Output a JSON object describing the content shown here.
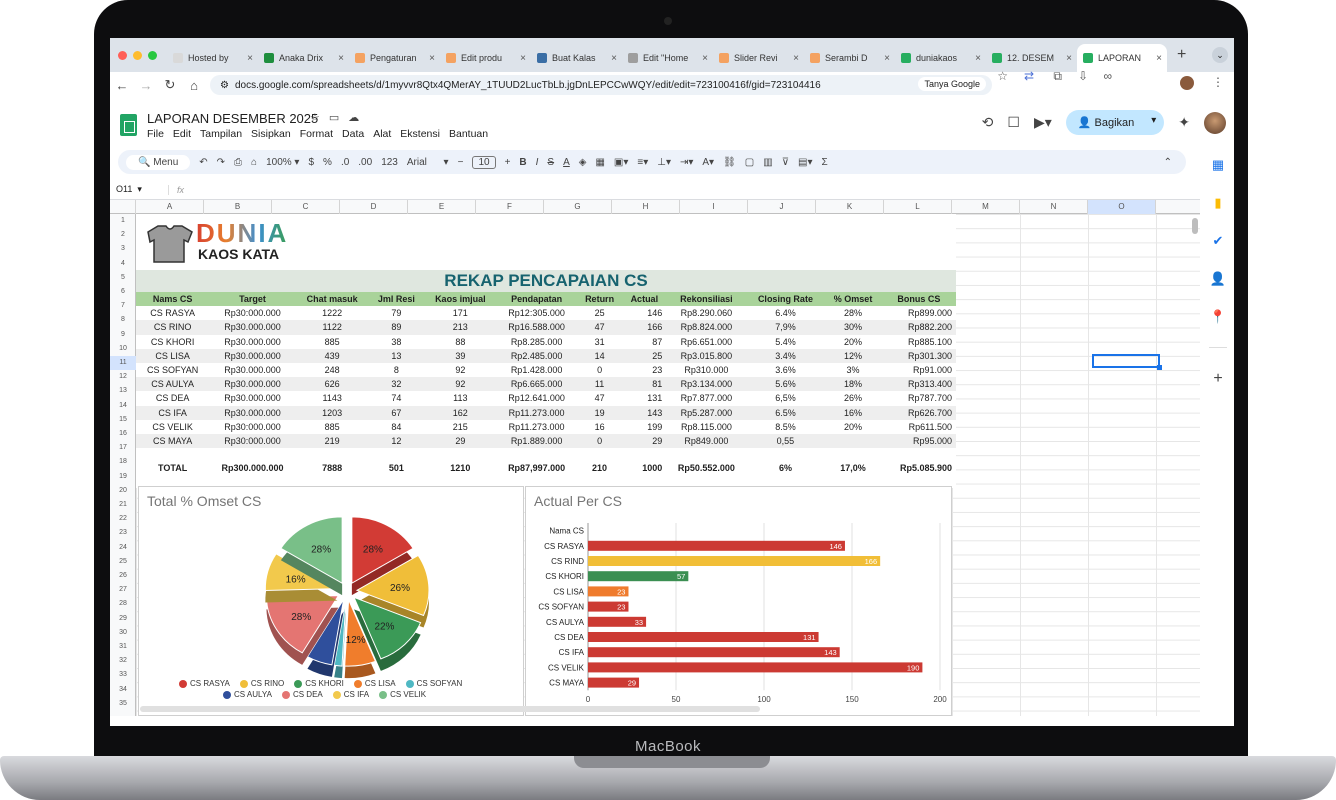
{
  "device": {
    "label": "MacBook"
  },
  "browser": {
    "tabs": [
      {
        "label": "Hosted by",
        "color": "#d9d9d9"
      },
      {
        "label": "Anaka Drix",
        "color": "#1e8e3e"
      },
      {
        "label": "Pengaturan",
        "color": "#f4a261"
      },
      {
        "label": "Edit produ",
        "color": "#f4a261"
      },
      {
        "label": "Buat Kalas",
        "color": "#3a6ea5"
      },
      {
        "label": "Edit \"Home",
        "color": "#9e9e9e"
      },
      {
        "label": "Slider Revi",
        "color": "#f4a261"
      },
      {
        "label": "Serambi D",
        "color": "#f4a261"
      },
      {
        "label": "duniakaos",
        "color": "#27ae60"
      },
      {
        "label": "12. DESEM",
        "color": "#27ae60"
      },
      {
        "label": "LAPORAN",
        "color": "#27ae60"
      }
    ],
    "url": "docs.google.com/spreadsheets/d/1myvvr8Qtx4QMerAY_1TUUD2LucTbLb.jgDnLEPCCwWQY/edit/edit=723100416f/gid=723104416",
    "ask_google": "Tanya Google"
  },
  "sheets": {
    "title": "LAPORAN DESEMBER 2025",
    "menu": [
      "File",
      "Edit",
      "Tampilan",
      "Sisipkan",
      "Format",
      "Data",
      "Alat",
      "Ekstensi",
      "Bantuan"
    ],
    "share": "Bagikan",
    "toolbar": {
      "menu": "Menu",
      "zoom": "100%",
      "currency": "$",
      "percent": "%",
      "dec1": ".0",
      "dec2": ".00",
      "num": "123",
      "font": "Arial",
      "font_size": "10",
      "bold": "B",
      "italic": "I",
      "strike": "S",
      "textcolor": "A"
    },
    "cell_ref": "O11",
    "columns": [
      "A",
      "B",
      "C",
      "D",
      "E",
      "F",
      "G",
      "H",
      "I",
      "J",
      "K",
      "L",
      "M",
      "N",
      "O"
    ],
    "rows": [
      "1",
      "2",
      "3",
      "4",
      "5",
      "6",
      "7",
      "8",
      "9",
      "10",
      "11",
      "12",
      "13",
      "14",
      "15",
      "16",
      "17",
      "18",
      "19",
      "20",
      "21",
      "22",
      "23",
      "24",
      "25",
      "26",
      "27",
      "28",
      "29",
      "30",
      "31",
      "32",
      "33",
      "34",
      "35"
    ]
  },
  "report": {
    "brand_top": "DUNIA",
    "brand_bottom": "KAOS KATA",
    "title": "REKAP PENCAPAIAN CS",
    "headers": [
      "Nams CS",
      "Target",
      "Chat masuk",
      "Jml Resi",
      "Kaos imjual",
      "Pendapatan",
      "Return",
      "Actual",
      "Rekonsiliasi",
      "Closing Rate",
      "% Omset",
      "Bonus CS"
    ],
    "rows": [
      [
        "CS RASYA",
        "Rp30:000.000",
        "1222",
        "79",
        "171",
        "Rp12:305.000",
        "25",
        "146",
        "Rp8.290.060",
        "6.4%",
        "28%",
        "Rp899.000"
      ],
      [
        "CS RINO",
        "Rp30.000.000",
        "1122",
        "89",
        "213",
        "Rp16.588.000",
        "47",
        "166",
        "Rp8.824.000",
        "7,9%",
        "30%",
        "Rp882.200"
      ],
      [
        "CS KHORI",
        "Rp30.000.000",
        "885",
        "38",
        "88",
        "Rp8.285.000",
        "31",
        "87",
        "Rp6.651.000",
        "5.4%",
        "20%",
        "Rp885.100"
      ],
      [
        "CS LISA",
        "Rp30.000.000",
        "439",
        "13",
        "39",
        "Rp2.485.000",
        "14",
        "25",
        "Rp3.015.800",
        "3.4%",
        "12%",
        "Rp301.300"
      ],
      [
        "CS SOFYAN",
        "Rp30.000.000",
        "248",
        "8",
        "92",
        "Rp1.428.000",
        "0",
        "23",
        "Rp310.000",
        "3.6%",
        "3%",
        "Rp91.000"
      ],
      [
        "CS AULYA",
        "Rp30.000.000",
        "626",
        "32",
        "92",
        "Rp6.665.000",
        "11",
        "81",
        "Rp3.134.000",
        "5.6%",
        "18%",
        "Rp313.400"
      ],
      [
        "CS DEA",
        "Rp30.000.000",
        "1143",
        "74",
        "113",
        "Rp12.641.000",
        "47",
        "131",
        "Rp7.877.000",
        "6,5%",
        "26%",
        "Rp787.700"
      ],
      [
        "CS IFA",
        "Rp30.000.000",
        "1203",
        "67",
        "162",
        "Rp11.273.000",
        "19",
        "143",
        "Rp5.287.000",
        "6.5%",
        "16%",
        "Rp626.700"
      ],
      [
        "CS VELIK",
        "Rp30:000.000",
        "885",
        "84",
        "215",
        "Rp11.273.000",
        "16",
        "199",
        "Rp8.115.000",
        "8.5%",
        "20%",
        "Rp611.500"
      ],
      [
        "CS MAYA",
        "Rp30:000.000",
        "219",
        "12",
        "29",
        "Rp1.889.000",
        "0",
        "29",
        "Rp849.000",
        "0,55",
        "",
        "Rp95.000"
      ]
    ],
    "total": [
      "TOTAL",
      "Rp300.000.000",
      "7888",
      "501",
      "1210",
      "Rp87,997.000",
      "210",
      "1000",
      "Rp50.552.000",
      "6%",
      "17,0%",
      "Rp5.085.900"
    ]
  },
  "chart_data": [
    {
      "type": "pie",
      "title": "Total % Omset CS",
      "slices": [
        {
          "label": "CS RASYA",
          "value": 28,
          "text": "28%",
          "color": "#d23b35"
        },
        {
          "label": "CS RINO",
          "value": 26,
          "text": "26%",
          "color": "#f0be39"
        },
        {
          "label": "CS KHORI",
          "value": 22,
          "text": "22%",
          "color": "#3b9a57"
        },
        {
          "label": "CS LISA",
          "value": 12,
          "text": "12%",
          "color": "#f07d2c"
        },
        {
          "label": "CS SOFYAN",
          "value": 3,
          "text": "",
          "color": "#4fb8c3"
        },
        {
          "label": "CS AULYA",
          "value": 10,
          "text": "",
          "color": "#2f4f9c"
        },
        {
          "label": "CS DEA",
          "value": 28,
          "text": "28%",
          "color": "#e47572"
        },
        {
          "label": "CS IFA",
          "value": 16,
          "text": "16%",
          "color": "#f2c94c"
        },
        {
          "label": "CS VELIK",
          "value": 28,
          "text": "28%",
          "color": "#79bf88"
        }
      ],
      "legend": [
        "CS RASYA",
        "CS RINO",
        "CS KHORI",
        "CS LISA",
        "CS SOFYAN",
        "CS AULYA",
        "CS DEA",
        "CS IFA",
        "CS VELIK"
      ],
      "legend_position": "bottom"
    },
    {
      "type": "bar",
      "orientation": "horizontal",
      "title": "Actual Per CS",
      "categories": [
        "Nama CS",
        "CS RASYA",
        "CS RIND",
        "CS KHORI",
        "CS LISA",
        "CS SOFYAN",
        "CS AULYA",
        "CS DEA",
        "CS IFA",
        "CS VELIK",
        "CS MAYA"
      ],
      "values": [
        null,
        146,
        166,
        57,
        23,
        23,
        33,
        131,
        143,
        190,
        29
      ],
      "colors": [
        "",
        "#cc3a33",
        "#f1be37",
        "#3b8f52",
        "#ef7b2d",
        "#cc3a33",
        "#cc3a33",
        "#cc3a33",
        "#cc3a33",
        "#cc3a33",
        "#cc3a33"
      ],
      "xticks": [
        "0",
        "50",
        "100",
        "150",
        "200"
      ],
      "xlim": [
        0,
        200
      ],
      "grid": true
    }
  ]
}
